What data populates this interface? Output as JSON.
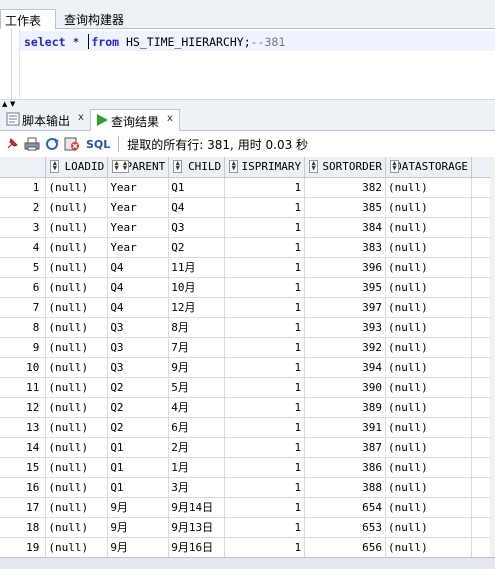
{
  "top_tabs": [
    "工作表",
    "查询构建器"
  ],
  "editor": {
    "kw_select": "select",
    "star": "*",
    "kw_from": "from",
    "table": "HS_TIME_HIERARCHY;",
    "comment": "--381"
  },
  "bottom_tabs": {
    "script_output": "脚本输出",
    "query_result": "查询结果",
    "close": "x"
  },
  "toolbar": {
    "sql_label": "SQL",
    "status": "提取的所有行: 381, 用时 0.03 秒"
  },
  "columns": [
    "LOADID",
    "PARENT",
    "CHILD",
    "ISPRIMARY",
    "SORTORDER",
    "DATASTORAGE"
  ],
  "rows": [
    [
      "1",
      "(null)",
      "Year",
      "Q1",
      "1",
      "382",
      "(null)"
    ],
    [
      "2",
      "(null)",
      "Year",
      "Q4",
      "1",
      "385",
      "(null)"
    ],
    [
      "3",
      "(null)",
      "Year",
      "Q3",
      "1",
      "384",
      "(null)"
    ],
    [
      "4",
      "(null)",
      "Year",
      "Q2",
      "1",
      "383",
      "(null)"
    ],
    [
      "5",
      "(null)",
      "Q4",
      "11月",
      "1",
      "396",
      "(null)"
    ],
    [
      "6",
      "(null)",
      "Q4",
      "10月",
      "1",
      "395",
      "(null)"
    ],
    [
      "7",
      "(null)",
      "Q4",
      "12月",
      "1",
      "397",
      "(null)"
    ],
    [
      "8",
      "(null)",
      "Q3",
      "8月",
      "1",
      "393",
      "(null)"
    ],
    [
      "9",
      "(null)",
      "Q3",
      "7月",
      "1",
      "392",
      "(null)"
    ],
    [
      "10",
      "(null)",
      "Q3",
      "9月",
      "1",
      "394",
      "(null)"
    ],
    [
      "11",
      "(null)",
      "Q2",
      "5月",
      "1",
      "390",
      "(null)"
    ],
    [
      "12",
      "(null)",
      "Q2",
      "4月",
      "1",
      "389",
      "(null)"
    ],
    [
      "13",
      "(null)",
      "Q2",
      "6月",
      "1",
      "391",
      "(null)"
    ],
    [
      "14",
      "(null)",
      "Q1",
      "2月",
      "1",
      "387",
      "(null)"
    ],
    [
      "15",
      "(null)",
      "Q1",
      "1月",
      "1",
      "386",
      "(null)"
    ],
    [
      "16",
      "(null)",
      "Q1",
      "3月",
      "1",
      "388",
      "(null)"
    ],
    [
      "17",
      "(null)",
      "9月",
      "9月14日",
      "1",
      "654",
      "(null)"
    ],
    [
      "18",
      "(null)",
      "9月",
      "9月13日",
      "1",
      "653",
      "(null)"
    ],
    [
      "19",
      "(null)",
      "9月",
      "9月16日",
      "1",
      "656",
      "(null)"
    ]
  ]
}
